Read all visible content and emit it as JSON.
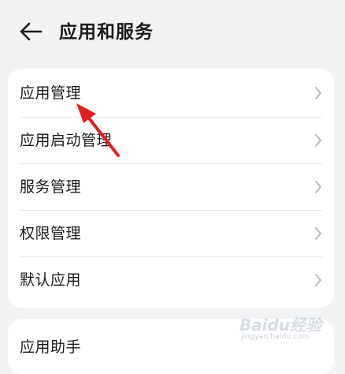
{
  "header": {
    "title": "应用和服务",
    "back_icon": "arrow-left-icon"
  },
  "settings_group": {
    "items": [
      {
        "label": "应用管理"
      },
      {
        "label": "应用启动管理"
      },
      {
        "label": "服务管理"
      },
      {
        "label": "权限管理"
      },
      {
        "label": "默认应用"
      }
    ]
  },
  "assistant_group": {
    "items": [
      {
        "label": "应用助手"
      }
    ]
  },
  "annotation": {
    "arrow_color": "#e02020"
  },
  "watermark": {
    "brand": "Baidu经验",
    "url": "jingyan.baidu.com"
  },
  "colors": {
    "background": "#f1f3f5",
    "card": "#ffffff",
    "text": "#1a1a1a",
    "chevron": "#b5b5b5"
  }
}
